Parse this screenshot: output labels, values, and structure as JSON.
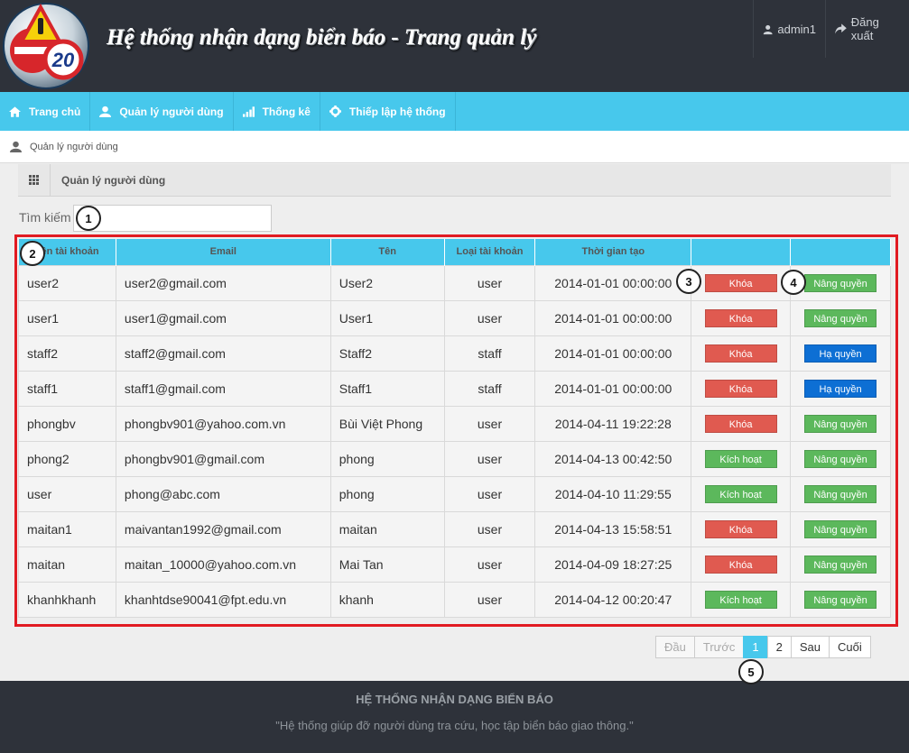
{
  "header": {
    "site_title": "Hệ thống nhận dạng biển báo - Trang quản lý",
    "logo_number": "20",
    "user_label": "admin1",
    "logout_label": "Đăng xuất"
  },
  "nav": {
    "items": [
      {
        "label": "Trang chủ",
        "icon": "home-icon"
      },
      {
        "label": "Quản lý người dùng",
        "icon": "user-icon"
      },
      {
        "label": "Thống kê",
        "icon": "bar-chart-icon"
      },
      {
        "label": "Thiếp lập hệ thống",
        "icon": "gear-icon"
      }
    ]
  },
  "breadcrumb": {
    "label": "Quản lý người dùng"
  },
  "panel": {
    "title": "Quản lý người dùng"
  },
  "search": {
    "label": "Tìm kiếm",
    "value": ""
  },
  "table": {
    "headers": [
      "Tên tài khoản",
      "Email",
      "Tên",
      "Loại tài khoản",
      "Thời gian tạo",
      "",
      ""
    ],
    "rows": [
      {
        "username": "user2",
        "email": "user2@gmail.com",
        "name": "User2",
        "type": "user",
        "created": "2014-01-01 00:00:00",
        "status_btn": "Khóa",
        "role_btn": "Nâng quyền"
      },
      {
        "username": "user1",
        "email": "user1@gmail.com",
        "name": "User1",
        "type": "user",
        "created": "2014-01-01 00:00:00",
        "status_btn": "Khóa",
        "role_btn": "Nâng quyền"
      },
      {
        "username": "staff2",
        "email": "staff2@gmail.com",
        "name": "Staff2",
        "type": "staff",
        "created": "2014-01-01 00:00:00",
        "status_btn": "Khóa",
        "role_btn": "Hạ quyền"
      },
      {
        "username": "staff1",
        "email": "staff1@gmail.com",
        "name": "Staff1",
        "type": "staff",
        "created": "2014-01-01 00:00:00",
        "status_btn": "Khóa",
        "role_btn": "Hạ quyền"
      },
      {
        "username": "phongbv",
        "email": "phongbv901@yahoo.com.vn",
        "name": "Bùi Việt Phong",
        "type": "user",
        "created": "2014-04-11 19:22:28",
        "status_btn": "Khóa",
        "role_btn": "Nâng quyền"
      },
      {
        "username": "phong2",
        "email": "phongbv901@gmail.com",
        "name": "phong",
        "type": "user",
        "created": "2014-04-13 00:42:50",
        "status_btn": "Kích hoạt",
        "role_btn": "Nâng quyền"
      },
      {
        "username": "user",
        "email": "phong@abc.com",
        "name": "phong",
        "type": "user",
        "created": "2014-04-10 11:29:55",
        "status_btn": "Kích hoạt",
        "role_btn": "Nâng quyền"
      },
      {
        "username": "maitan1",
        "email": "maivantan1992@gmail.com",
        "name": "maitan",
        "type": "user",
        "created": "2014-04-13 15:58:51",
        "status_btn": "Khóa",
        "role_btn": "Nâng quyền"
      },
      {
        "username": "maitan",
        "email": "maitan_10000@yahoo.com.vn",
        "name": "Mai Tan",
        "type": "user",
        "created": "2014-04-09 18:27:25",
        "status_btn": "Khóa",
        "role_btn": "Nâng quyền"
      },
      {
        "username": "khanhkhanh",
        "email": "khanhtdse90041@fpt.edu.vn",
        "name": "khanh",
        "type": "user",
        "created": "2014-04-12 00:20:47",
        "status_btn": "Kích hoạt",
        "role_btn": "Nâng quyền"
      }
    ]
  },
  "pagination": {
    "first": "Đầu",
    "prev": "Trước",
    "pages": [
      "1",
      "2"
    ],
    "current_page": "1",
    "next": "Sau",
    "last": "Cuối"
  },
  "callouts": [
    "1",
    "2",
    "3",
    "4",
    "5"
  ],
  "footer": {
    "title": "HỆ THỐNG NHẬN DẠNG BIỂN BÁO",
    "description": "\"Hệ thống giúp đỡ người dùng tra cứu, học tập biển báo giao thông.\""
  },
  "colors": {
    "header_bg": "#2e323a",
    "accent": "#47c8ec",
    "lock_red": "#e05a50",
    "success_green": "#5cb85c",
    "demote_blue": "#0d6fd4",
    "frame_red": "#e11b22"
  }
}
